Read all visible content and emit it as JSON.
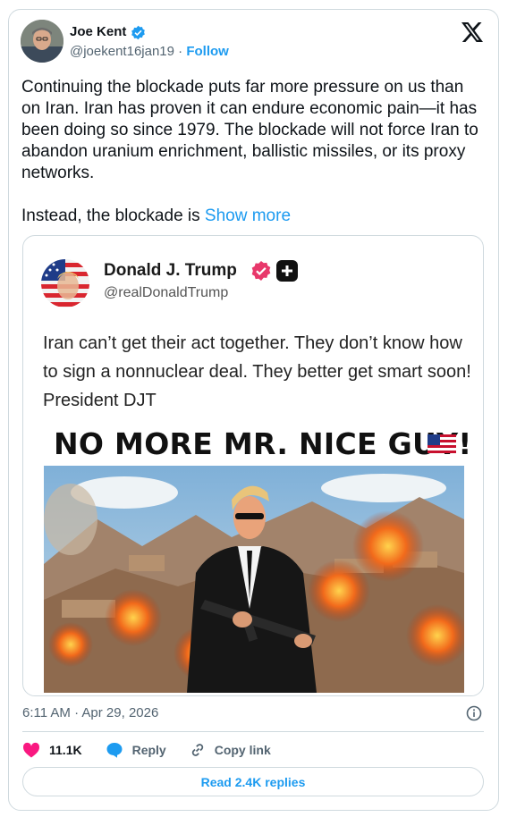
{
  "author": {
    "name": "Joe Kent",
    "handle": "@joekent16jan19",
    "separator": "·",
    "follow_label": "Follow"
  },
  "tweet": {
    "paragraph_1": "Continuing the blockade puts far more pressure on us than on Iran. Iran has proven it can endure economic pain—it has been doing so since 1979. The blockade will not force Iran to abandon uranium enrichment, ballistic missiles, or its proxy networks.",
    "paragraph_2": "Instead, the blockade is ",
    "show_more": "Show more"
  },
  "quoted_post": {
    "name": "Donald J. Trump",
    "handle": "@realDonaldTrump",
    "text": "Iran can’t get their act together. They don’t know how to sign a nonnuclear deal. They better get smart soon! President DJT",
    "headline": "NO MORE MR. NICE GUY!",
    "flag_icon": "us-flag-icon"
  },
  "meta": {
    "timestamp": "6:11 AM · Apr 29, 2026"
  },
  "actions": {
    "likes": "11.1K",
    "reply_label": "Reply",
    "copy_link_label": "Copy link"
  },
  "read_replies_label": "Read 2.4K replies",
  "colors": {
    "accent": "#1d9bf0",
    "like": "#f91880",
    "text": "#0f1419",
    "secondary": "#536471",
    "border": "#cfd9de",
    "truth_badge": "#e8386b"
  }
}
